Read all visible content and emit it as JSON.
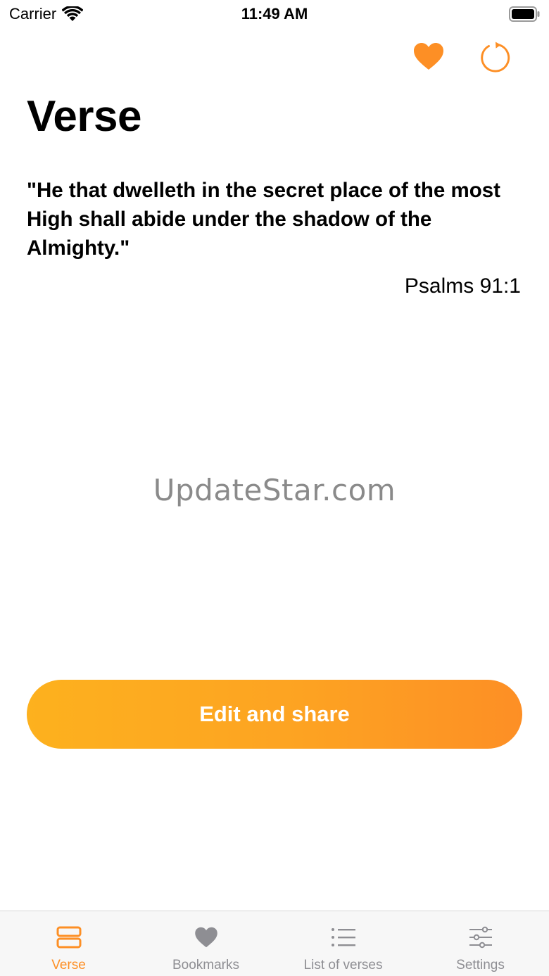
{
  "status_bar": {
    "carrier": "Carrier",
    "time": "11:49 AM"
  },
  "colors": {
    "accent": "#fd8f25",
    "accent_light": "#fdb11e",
    "inactive": "#8e8e93"
  },
  "header": {
    "icons": [
      "heart-icon",
      "refresh-icon"
    ]
  },
  "page": {
    "title": "Verse",
    "verse_text": "\"He that dwelleth in the secret place of the most High shall abide under the shadow of the Almighty.\"",
    "verse_reference": "Psalms 91:1",
    "watermark": "UpdateStar.com"
  },
  "actions": {
    "edit_share_label": "Edit and share"
  },
  "tab_bar": {
    "items": [
      {
        "label": "Verse",
        "icon": "verse-card-icon",
        "active": true
      },
      {
        "label": "Bookmarks",
        "icon": "heart-icon",
        "active": false
      },
      {
        "label": "List of verses",
        "icon": "list-icon",
        "active": false
      },
      {
        "label": "Settings",
        "icon": "sliders-icon",
        "active": false
      }
    ]
  }
}
